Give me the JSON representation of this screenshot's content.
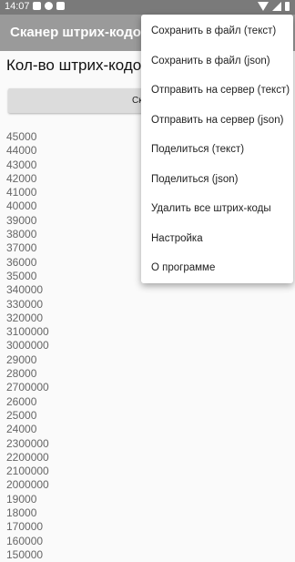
{
  "status": {
    "time": "14:07"
  },
  "app": {
    "title": "Сканер штрих-кодов"
  },
  "count_label": "Кол-во штрих-кодов:",
  "scan_button": "Сканер",
  "codes": [
    "45000",
    "44000",
    "43000",
    "42000",
    "41000",
    "40000",
    "39000",
    "38000",
    "37000",
    "36000",
    "35000",
    "340000",
    "330000",
    "320000",
    "3100000",
    "3000000",
    "29000",
    "28000",
    "2700000",
    "26000",
    "25000",
    "24000",
    "2300000",
    "2200000",
    "2100000",
    "2000000",
    "19000",
    "18000",
    "170000",
    "160000",
    "150000"
  ],
  "menu": {
    "items": [
      "Сохранить в файл (текст)",
      "Сохранить в файл (json)",
      "Отправить на сервер (текст)",
      "Отправить на сервер (json)",
      "Поделиться (текст)",
      "Поделиться (json)",
      "Удалить все штрих-коды",
      "Настройка",
      "О программе"
    ]
  }
}
